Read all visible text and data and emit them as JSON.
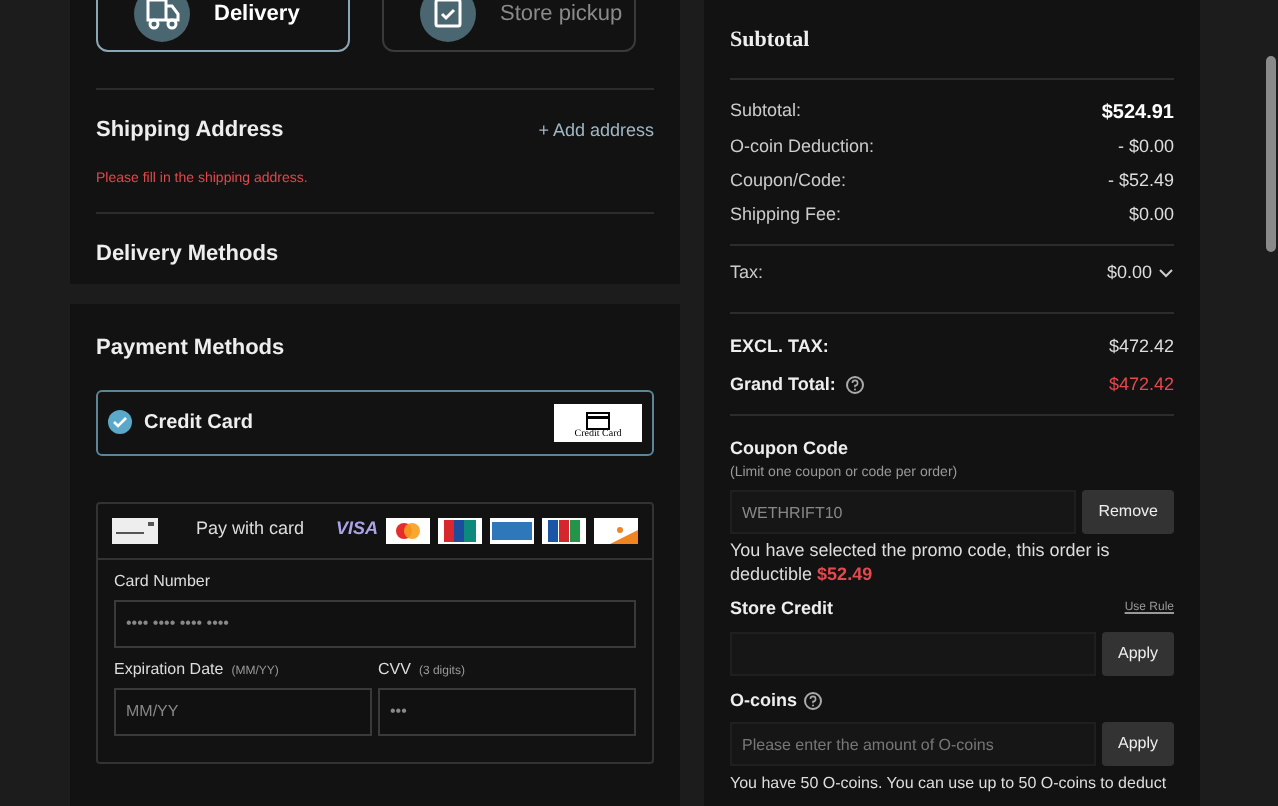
{
  "fulfillment": [
    {
      "label": "Delivery",
      "kind": "truck",
      "selected": true
    },
    {
      "label": "Store pickup",
      "kind": "calendar",
      "selected": false
    }
  ],
  "shipping": {
    "title": "Shipping Address",
    "action": "+ Add address",
    "error": "Please fill in the shipping address."
  },
  "delivery_methods": {
    "title": "Delivery Methods"
  },
  "payment": {
    "title": "Payment Methods",
    "methods": [
      {
        "label": "Credit Card",
        "badge": "Credit Card",
        "selected": true
      }
    ],
    "card_form": {
      "title": "Pay with card",
      "brands": [
        {
          "kind": "visa",
          "label": "VISA"
        },
        {
          "kind": "mastercard"
        },
        {
          "kind": "unionpay"
        },
        {
          "kind": "amex"
        },
        {
          "kind": "jcb"
        },
        {
          "kind": "discover"
        }
      ],
      "card_number": {
        "label": "Card Number",
        "placeholder": "•••• •••• •••• ••••"
      },
      "expiry": {
        "label": "Expiration Date",
        "hint": "(MM/YY)",
        "placeholder": "MM/YY"
      },
      "cvv": {
        "label": "CVV",
        "hint": "(3 digits)",
        "placeholder": "•••"
      }
    }
  },
  "summary": {
    "title": "Subtotal",
    "rows": [
      {
        "label": "Subtotal:",
        "value": "$524.91",
        "kind": "strong"
      },
      {
        "label": "O-coin Deduction:",
        "value": "- $0.00",
        "kind": "plain"
      },
      {
        "label": "Coupon/Code:",
        "value": "- $52.49",
        "kind": "plain"
      },
      {
        "label": "Shipping Fee:",
        "value": "$0.00",
        "kind": "plain"
      }
    ],
    "tax": {
      "label": "Tax:",
      "value": "$0.00",
      "expanded": false
    },
    "excl_tax": {
      "label": "EXCL. TAX:",
      "value": "$472.42"
    },
    "grand_total": {
      "label": "Grand Total:",
      "value": "$472.42"
    }
  },
  "coupon": {
    "title": "Coupon Code",
    "note": "(Limit one coupon or code per order)",
    "value": "WETHRIFT10",
    "button": "Remove",
    "message": "You have selected the promo code, this order is deductible **$52.49**"
  },
  "store_credit": {
    "title": "Store Credit",
    "link": "Use Rule",
    "button": "Apply"
  },
  "ocoins": {
    "title": "O-coins",
    "placeholder": "Please enter the amount of O-coins",
    "button": "Apply",
    "message": "You have 50 O-coins. You can use up to 50 O-coins to deduct"
  }
}
